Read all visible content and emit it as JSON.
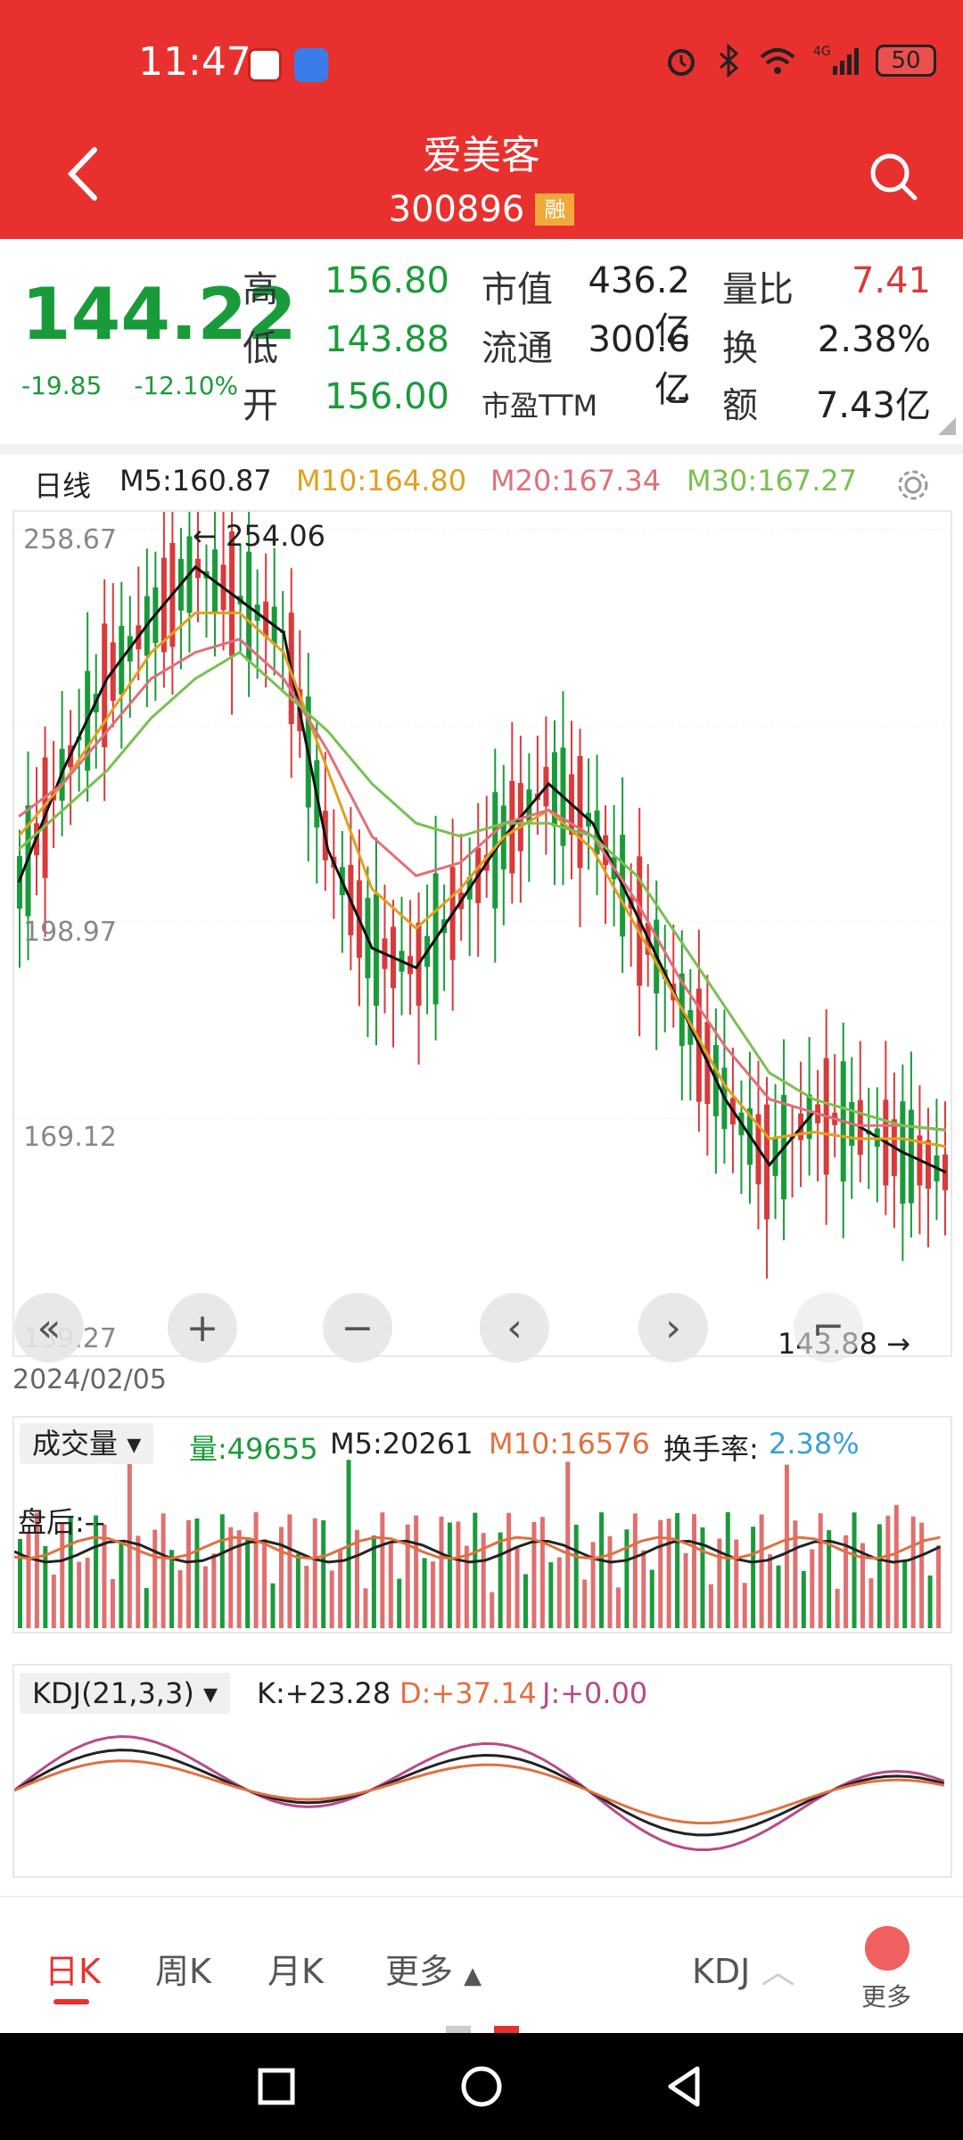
{
  "status": {
    "time": "11:47",
    "battery": "50",
    "network": "4G"
  },
  "header": {
    "title": "爱美客",
    "code": "300896",
    "badge": "融"
  },
  "quote": {
    "price": "144.22",
    "change": "-19.85",
    "change_pct": "-12.10%",
    "labels": {
      "high": "高",
      "low": "低",
      "open": "开",
      "mcap": "市值",
      "float": "流通",
      "pe": "市盈TTM",
      "vol_ratio": "量比",
      "turnover": "换",
      "amount": "额"
    },
    "values": {
      "high": "156.80",
      "low": "143.88",
      "open": "156.00",
      "mcap": "436.2亿",
      "float": "300.6亿",
      "pe": "--",
      "vol_ratio": "7.41",
      "turnover": "2.38%",
      "amount": "7.43亿"
    }
  },
  "ma_legend": {
    "period": "日线",
    "m5": "M5:160.87",
    "m10": "M10:164.80",
    "m20": "M20:167.34",
    "m30": "M30:167.27"
  },
  "colors": {
    "up": "#d93a3a",
    "down": "#1a9b3a",
    "m5": "#111111",
    "m10": "#e0a020",
    "m20": "#e0707a",
    "m30": "#7ac050",
    "header": "#e8312f"
  },
  "chart_main": {
    "y_ticks": [
      "258.67",
      "198.97",
      "169.12",
      "139.27"
    ],
    "max_marker": "254.06",
    "min_marker": "143.88",
    "start_date": "2024/02/05"
  },
  "vol_legend": {
    "selector": "成交量",
    "vol": "量:49655",
    "m5": "M5:20261",
    "m10": "M10:16576",
    "turnover_label": "换手率:",
    "turnover_value": "2.38%",
    "after_hours": "盘后:--"
  },
  "kdj_legend": {
    "selector": "KDJ(21,3,3)",
    "k": "K:+23.28",
    "d": "D:+37.14",
    "j": "J:+0.00"
  },
  "bottom_tabs": {
    "day": "日K",
    "week": "周K",
    "month": "月K",
    "more": "更多",
    "indicator": "KDJ",
    "more_btn": "更多"
  },
  "chart_data": {
    "type": "candlestick",
    "series": [
      {
        "name": "M5",
        "values": [
          205,
          222,
          236,
          245,
          253,
          248,
          243,
          210,
          195,
          192,
          202,
          212,
          220,
          214,
          200,
          186,
          172,
          162,
          170,
          168,
          164,
          160.87
        ]
      },
      {
        "name": "M10",
        "values": [
          212,
          220,
          230,
          240,
          246,
          246,
          240,
          222,
          204,
          198,
          204,
          212,
          216,
          210,
          198,
          186,
          174,
          166,
          167,
          166,
          166,
          164.8
        ]
      },
      {
        "name": "M20",
        "values": [
          215,
          220,
          228,
          236,
          240,
          242,
          236,
          225,
          212,
          206,
          208,
          214,
          216,
          212,
          202,
          190,
          180,
          172,
          170,
          168,
          168,
          167.34
        ]
      },
      {
        "name": "M30",
        "values": [
          210,
          216,
          222,
          230,
          236,
          240,
          234,
          228,
          220,
          214,
          212,
          214,
          214,
          212,
          206,
          196,
          186,
          176,
          172,
          170,
          168,
          167.27
        ]
      }
    ]
  }
}
